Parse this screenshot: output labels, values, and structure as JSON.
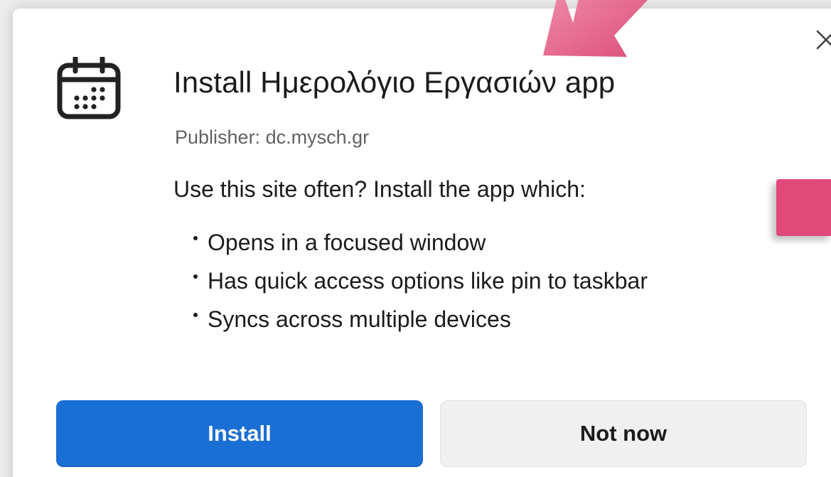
{
  "dialog": {
    "title": "Install Ημερολόγιο Εργασιών app",
    "publisher": "Publisher: dc.mysch.gr",
    "intro": "Use this site often? Install the app which:",
    "features": [
      "Opens in a focused window",
      "Has quick access options like pin to taskbar",
      "Syncs across multiple devices"
    ],
    "icons": {
      "app": "calendar-icon",
      "close": "close-icon"
    }
  },
  "buttons": {
    "install": "Install",
    "not_now": "Not now"
  },
  "colors": {
    "accent": "#1a6fd4",
    "annotation": "#e0497a"
  }
}
